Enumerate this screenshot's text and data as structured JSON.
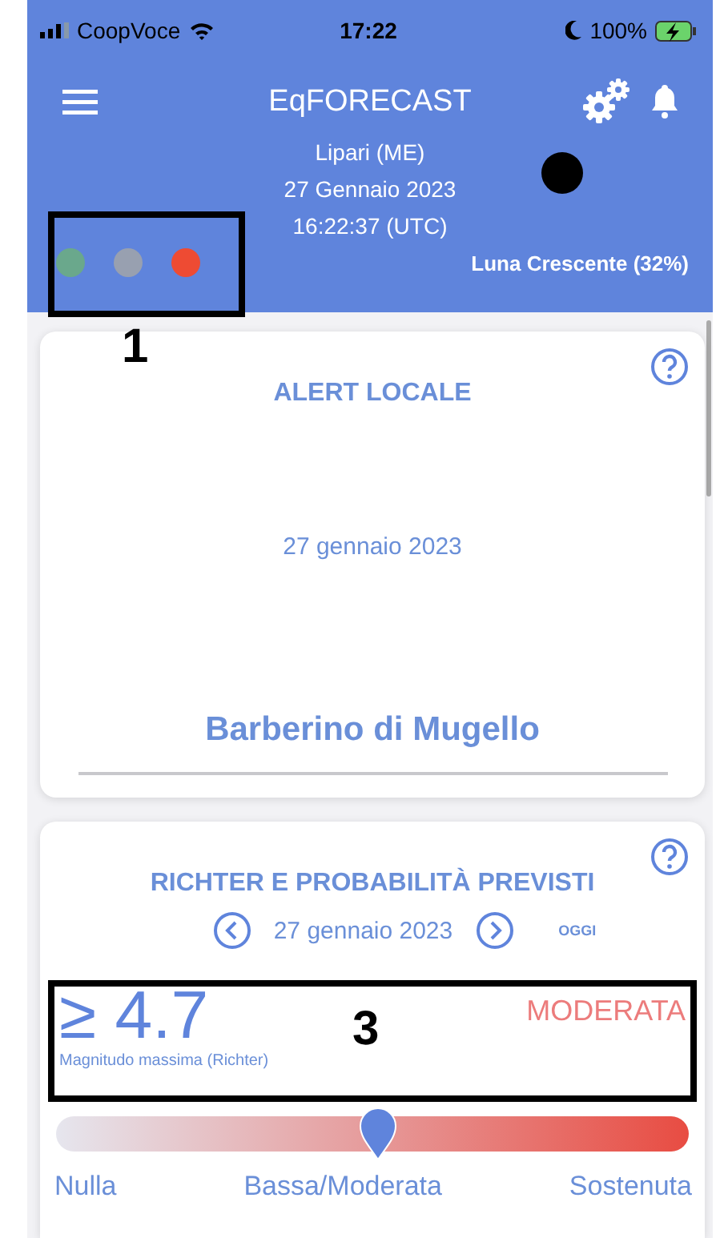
{
  "status_bar": {
    "carrier": "CoopVoce",
    "time": "17:22",
    "battery": "100%"
  },
  "header": {
    "title": "EqFORECAST",
    "location": "Lipari (ME)",
    "date": "27 Gennaio 2023",
    "time": "16:22:37 (UTC)",
    "moon_phase": "Luna Crescente (32%)",
    "alert_dots": [
      {
        "color": "#6aa88c"
      },
      {
        "color": "#98a0b0"
      },
      {
        "color": "#ee4b33"
      }
    ]
  },
  "alert_card": {
    "title": "ALERT LOCALE",
    "date": "27 gennaio 2023",
    "place": "Barberino di Mugello"
  },
  "richter_card": {
    "title": "RICHTER E PROBABILITÀ PREVISTI",
    "date": "27 gennaio 2023",
    "today": "OGGI",
    "magnitude": "≥ 4.7",
    "magnitude_label": "Magnitudo massima (Richter)",
    "probability": "MODERATA",
    "slider": {
      "level": 0.51,
      "labels": [
        "Nulla",
        "Bassa/Moderata",
        "Sostenuta"
      ]
    }
  },
  "annotations": [
    {
      "label": "1"
    },
    {
      "label": "3"
    }
  ]
}
